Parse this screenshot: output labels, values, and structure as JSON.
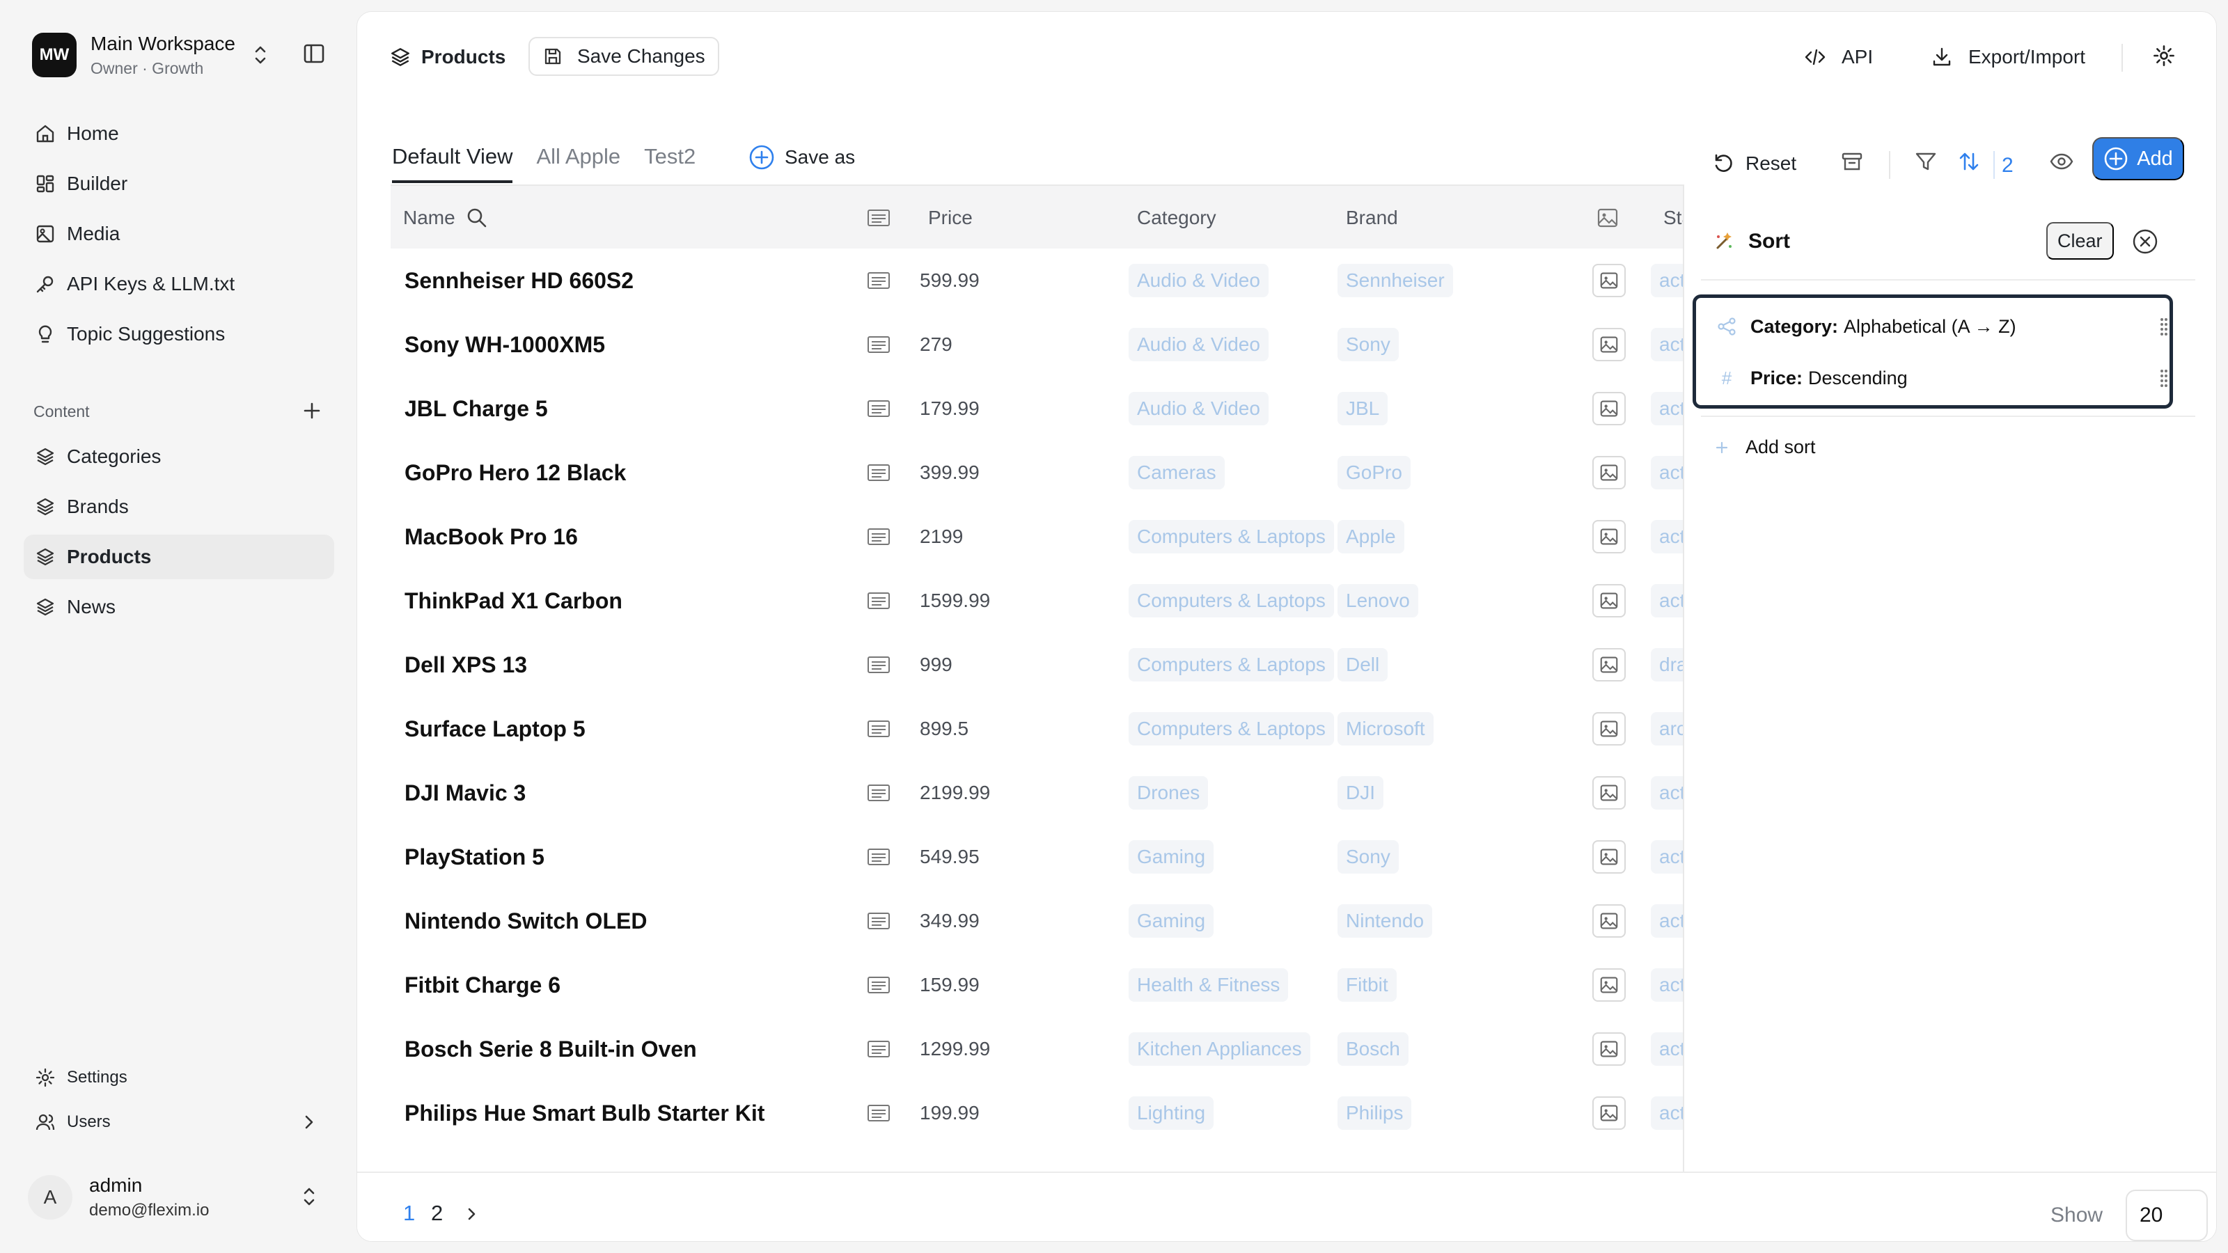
{
  "workspace": {
    "initials": "MW",
    "name": "Main Workspace",
    "subtitle": "Owner · Growth"
  },
  "nav": {
    "home": "Home",
    "builder": "Builder",
    "media": "Media",
    "api_keys": "API Keys & LLM.txt",
    "topics": "Topic Suggestions",
    "content_label": "Content",
    "categories": "Categories",
    "brands": "Brands",
    "products": "Products",
    "news": "News",
    "settings": "Settings",
    "users": "Users"
  },
  "user": {
    "initial": "A",
    "name": "admin",
    "email": "demo@flexim.io"
  },
  "topbar": {
    "title": "Products",
    "save_changes": "Save Changes",
    "api": "API",
    "export_import": "Export/Import"
  },
  "views": {
    "tabs": [
      "Default View",
      "All Apple",
      "Test2"
    ],
    "save_as": "Save as"
  },
  "toolbar": {
    "reset": "Reset",
    "sort_count": "2",
    "add": "Add"
  },
  "table": {
    "headers": {
      "name": "Name",
      "price": "Price",
      "category": "Category",
      "brand": "Brand",
      "status": "Status"
    },
    "rows": [
      {
        "name": "Sennheiser HD 660S2",
        "price": "599.99",
        "category": "Audio & Video",
        "brand": "Sennheiser",
        "status": "active"
      },
      {
        "name": "Sony WH-1000XM5",
        "price": "279",
        "category": "Audio & Video",
        "brand": "Sony",
        "status": "active"
      },
      {
        "name": "JBL Charge 5",
        "price": "179.99",
        "category": "Audio & Video",
        "brand": "JBL",
        "status": "active"
      },
      {
        "name": "GoPro Hero 12 Black",
        "price": "399.99",
        "category": "Cameras",
        "brand": "GoPro",
        "status": "active"
      },
      {
        "name": "MacBook Pro 16",
        "price": "2199",
        "category": "Computers & Laptops",
        "brand": "Apple",
        "status": "active"
      },
      {
        "name": "ThinkPad X1 Carbon",
        "price": "1599.99",
        "category": "Computers & Laptops",
        "brand": "Lenovo",
        "status": "active"
      },
      {
        "name": "Dell XPS 13",
        "price": "999",
        "category": "Computers & Laptops",
        "brand": "Dell",
        "status": "draft"
      },
      {
        "name": "Surface Laptop 5",
        "price": "899.5",
        "category": "Computers & Laptops",
        "brand": "Microsoft",
        "status": "archived"
      },
      {
        "name": "DJI Mavic 3",
        "price": "2199.99",
        "category": "Drones",
        "brand": "DJI",
        "status": "active"
      },
      {
        "name": "PlayStation 5",
        "price": "549.95",
        "category": "Gaming",
        "brand": "Sony",
        "status": "active"
      },
      {
        "name": "Nintendo Switch OLED",
        "price": "349.99",
        "category": "Gaming",
        "brand": "Nintendo",
        "status": "active"
      },
      {
        "name": "Fitbit Charge 6",
        "price": "159.99",
        "category": "Health & Fitness",
        "brand": "Fitbit",
        "status": "active"
      },
      {
        "name": "Bosch Serie 8 Built-in Oven",
        "price": "1299.99",
        "category": "Kitchen Appliances",
        "brand": "Bosch",
        "status": "active"
      },
      {
        "name": "Philips Hue Smart Bulb Starter Kit",
        "price": "199.99",
        "category": "Lighting",
        "brand": "Philips",
        "status": "active"
      }
    ]
  },
  "sort_panel": {
    "title": "Sort",
    "clear": "Clear",
    "rules": [
      {
        "field": "Category:",
        "direction": "Alphabetical (A → Z)"
      },
      {
        "field": "Price:",
        "direction": "Descending"
      }
    ],
    "add_sort": "Add sort"
  },
  "pagination": {
    "page_1": "1",
    "page_2": "2",
    "next": "›",
    "show_label": "Show",
    "page_size": "20"
  },
  "colors": {
    "accent": "#2f80ed",
    "chip_text": "#a9c7e8",
    "chip_bg": "#f3f5f8"
  }
}
